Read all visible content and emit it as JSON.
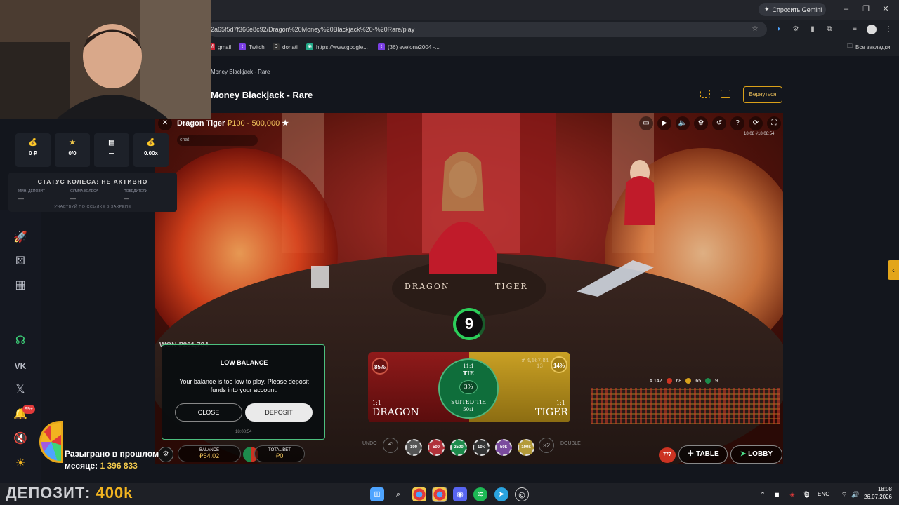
{
  "browser": {
    "gemini_label": "Спросить Gemini",
    "url": "2a65f5d7f366e8c92/Dragon%20Money%20Blackjack%20-%20Rare/play",
    "bookmarks": [
      "gmail",
      "Twitch",
      "donati",
      "https://www.google...",
      "(36) evelone2004 -..."
    ],
    "all_bookmarks": "Все закладки"
  },
  "site": {
    "breadcrumb": "Money Blackjack - Rare",
    "title": "Money Blackjack - Rare",
    "back_label": "Вернуться",
    "accent": "#d9a019"
  },
  "game": {
    "name": "Dragon Tiger",
    "limits": "₽100 - 500,000",
    "chat_placeholder": "chat",
    "timestamp": "18:08 #18:08:54",
    "table_dragon": "DRAGON",
    "table_tiger": "TIGER",
    "timer": "9",
    "win_text": "WON ₽201,784",
    "dragon_pct": "85%",
    "tiger_pct": "14%",
    "tie_pct": "3%",
    "dragon_odds": "1:1",
    "tiger_odds": "1:1",
    "tie_odds": "11:1",
    "suited_odds": "50:1",
    "dragon_label": "DRAGON",
    "tiger_label": "TIGER",
    "tie_label": "TIE",
    "suited_label": "SUITED TIE",
    "tiger_bet": "# 4,167.84",
    "tiger_count": "13",
    "road_counts": [
      "# 142",
      "68",
      "65",
      "9"
    ],
    "modal": {
      "title": "LOW BALANCE",
      "message": "Your balance is too low to play. Please deposit funds into your account.",
      "close": "CLOSE",
      "deposit": "DEPOSIT",
      "time": "18:08:54"
    },
    "balance_label": "BALANCE",
    "balance_value": "₽54.02",
    "total_bet_label": "TOTAL BET",
    "total_bet_value": "₽0",
    "undo": "UNDO",
    "double": "DOUBLE",
    "x2": "×2",
    "chips": [
      "100",
      "500",
      "2500",
      "10k",
      "50k",
      "100k"
    ],
    "table_btn": "TABLE",
    "lobby_btn": "LOBBY"
  },
  "overlay": {
    "stats": [
      {
        "icon": "coin-bag-icon",
        "value": "0 ₽"
      },
      {
        "icon": "star-icon",
        "value": "0/0"
      },
      {
        "icon": "card-icon",
        "value": "—"
      },
      {
        "icon": "money-bag-icon",
        "value": "0.00x"
      }
    ],
    "wheel_status": "СТАТУС КОЛЕСА: НЕ АКТИВНО",
    "wheel_cols": [
      "МИН. ДЕПОЗИТ",
      "СУММА КОЛЕСА",
      "ПОБЕДИТЕЛИ"
    ],
    "wheel_vals": [
      "—",
      "—",
      "—"
    ],
    "wheel_foot": "УЧАСТВУЙ ПО ССЫЛКЕ В ЗАКРЕПЕ",
    "prev_month_text": "Разыграно в прошлом",
    "prev_month_suffix": "месяце:",
    "prev_month_value": "1 396 833",
    "notif_badge": "99+",
    "deposit_label": "ДЕПОЗИТ:",
    "deposit_amount": "400k"
  },
  "taskbar": {
    "lang": "ENG",
    "time": "18:08",
    "date": "26.07.2026"
  }
}
